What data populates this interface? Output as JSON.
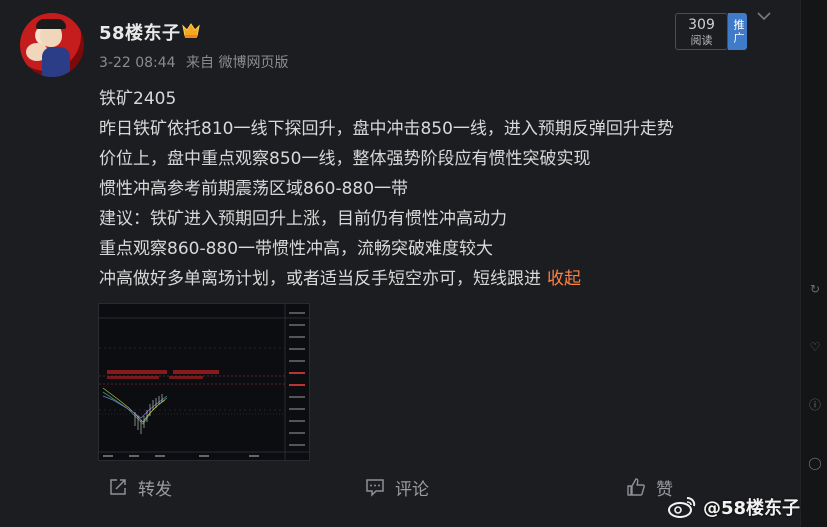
{
  "post": {
    "username": "58楼东子",
    "badge_icon": "vip-crown-icon",
    "time": "3-22 08:44",
    "source": "来自 微博网页版",
    "reads_count": "309",
    "reads_label": "阅读",
    "promote_label": "推广",
    "lines": [
      "铁矿2405",
      "昨日铁矿依托810一线下探回升，盘中冲击850一线，进入预期反弹回升走势",
      "价位上，盘中重点观察850一线，整体强势阶段应有惯性突破实现",
      "惯性冲高参考前期震荡区域860-880一带",
      "建议：铁矿进入预期回升上涨，目前仍有惯性冲高动力",
      "重点观察860-880一带惯性冲高，流畅突破难度较大",
      "冲高做好多单离场计划，或者适当反手短空亦可，短线跟进"
    ],
    "collapse_label": "收起",
    "accent_color": "#ff8140"
  },
  "actions": {
    "repost": "转发",
    "comment": "评论",
    "like": "赞"
  },
  "watermark": "@58楼东子"
}
